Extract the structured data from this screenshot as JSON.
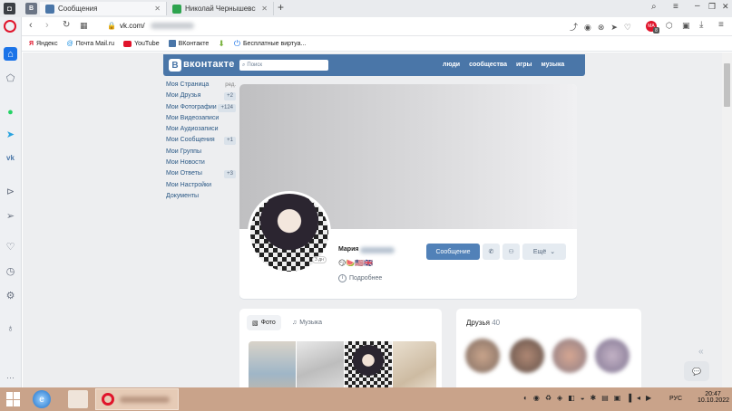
{
  "browser": {
    "tabs": [
      {
        "label": "Сообщения"
      },
      {
        "label": "Николай Чернышевский"
      }
    ],
    "url": "vk.com/",
    "bookmarks": [
      {
        "label": "Яндекс"
      },
      {
        "label": "Почта Mail.ru"
      },
      {
        "label": "YouTube"
      },
      {
        "label": "ВКонтакте"
      },
      {
        "label": "Бесплатные виртуа..."
      }
    ],
    "notif_count": "8",
    "avatar_badge": "MA"
  },
  "vk": {
    "logo": "вконтакте",
    "search_placeholder": "Поиск",
    "topnav": [
      "люди",
      "сообщества",
      "игры",
      "музыка"
    ],
    "left_menu": [
      {
        "label": "Моя Страница",
        "badge": "ред."
      },
      {
        "label": "Мои Друзья",
        "badge": "+2"
      },
      {
        "label": "Мои Фотографии",
        "badge": "+124"
      },
      {
        "label": "Мои Видеозаписи",
        "badge": ""
      },
      {
        "label": "Мои Аудиозаписи",
        "badge": ""
      },
      {
        "label": "Мои Сообщения",
        "badge": "+1"
      },
      {
        "label": "Мои Группы",
        "badge": ""
      },
      {
        "label": "Мои Новости",
        "badge": ""
      },
      {
        "label": "Мои Ответы",
        "badge": "+3"
      },
      {
        "label": "Мои Настройки",
        "badge": ""
      },
      {
        "label": "Документы",
        "badge": ""
      }
    ],
    "profile": {
      "name": "Мария",
      "online_badge": "3 дн",
      "emoji_status": "😏🍉🇺🇸🇬🇧",
      "more_info": "Подробнее",
      "message_button": "Сообщение",
      "more_button": "Ещё"
    },
    "photos_tab": "Фото",
    "music_tab": "Музыка",
    "friends": {
      "label": "Друзья",
      "count": "40"
    }
  },
  "taskbar": {
    "lang": "РУС",
    "time": "20:47",
    "date": "10.10.2022"
  },
  "colors": {
    "vk_blue": "#4a76a8",
    "button_blue": "#5181b8",
    "opera_red": "#e0142b"
  }
}
